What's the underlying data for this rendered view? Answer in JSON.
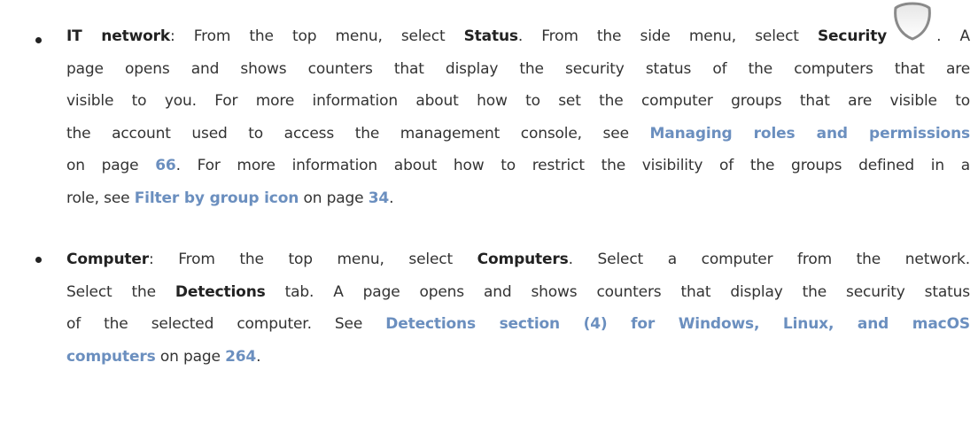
{
  "bullets": [
    {
      "lines": [
        {
          "segments": [
            {
              "t": "IT network",
              "s": "b"
            },
            {
              "t": ": From the top menu, select ",
              "s": "n"
            },
            {
              "t": "Status",
              "s": "b"
            },
            {
              "t": ". From the side menu, select ",
              "s": "n"
            },
            {
              "t": "Security",
              "s": "b"
            },
            {
              "t": "",
              "s": "icon",
              "icon": "shield-icon"
            },
            {
              "t": ". A",
              "s": "n"
            }
          ]
        },
        {
          "segments": [
            {
              "t": "page opens and shows counters that display the security status of the computers that are",
              "s": "n"
            }
          ]
        },
        {
          "segments": [
            {
              "t": "visible to you. For more information about how to set the computer groups that are visible to",
              "s": "n"
            }
          ]
        },
        {
          "segments": [
            {
              "t": "the account used to access the management console, see ",
              "s": "n"
            },
            {
              "t": "Managing roles and permissions",
              "s": "link"
            }
          ]
        },
        {
          "segments": [
            {
              "t": "on page ",
              "s": "n"
            },
            {
              "t": "66",
              "s": "link"
            },
            {
              "t": ". For more information about how to restrict the visibility of the groups defined in a",
              "s": "n"
            }
          ]
        },
        {
          "segments": [
            {
              "t": "role, see ",
              "s": "n"
            },
            {
              "t": "Filter by group icon",
              "s": "link"
            },
            {
              "t": "  on page ",
              "s": "n"
            },
            {
              "t": "34",
              "s": "link"
            },
            {
              "t": ".",
              "s": "n"
            }
          ]
        }
      ]
    },
    {
      "lines": [
        {
          "segments": [
            {
              "t": "Computer",
              "s": "b"
            },
            {
              "t": ": From the top menu, select ",
              "s": "n"
            },
            {
              "t": "Computers",
              "s": "b"
            },
            {
              "t": ". Select a computer from the network.",
              "s": "n"
            }
          ]
        },
        {
          "segments": [
            {
              "t": "Select the ",
              "s": "n"
            },
            {
              "t": "Detections",
              "s": "b"
            },
            {
              "t": " tab. A page opens and shows counters that display the security status",
              "s": "n"
            }
          ]
        },
        {
          "segments": [
            {
              "t": "of the selected computer. See ",
              "s": "n"
            },
            {
              "t": "Detections section (4) for Windows, Linux, and macOS",
              "s": "link"
            }
          ]
        },
        {
          "segments": [
            {
              "t": "computers",
              "s": "link"
            },
            {
              "t": " on page ",
              "s": "n"
            },
            {
              "t": "264",
              "s": "link"
            },
            {
              "t": ".",
              "s": "n"
            }
          ]
        }
      ]
    }
  ],
  "colors": {
    "text": "#333333",
    "link": "#6b8fbf",
    "shield_stroke": "#8a8a8a"
  }
}
